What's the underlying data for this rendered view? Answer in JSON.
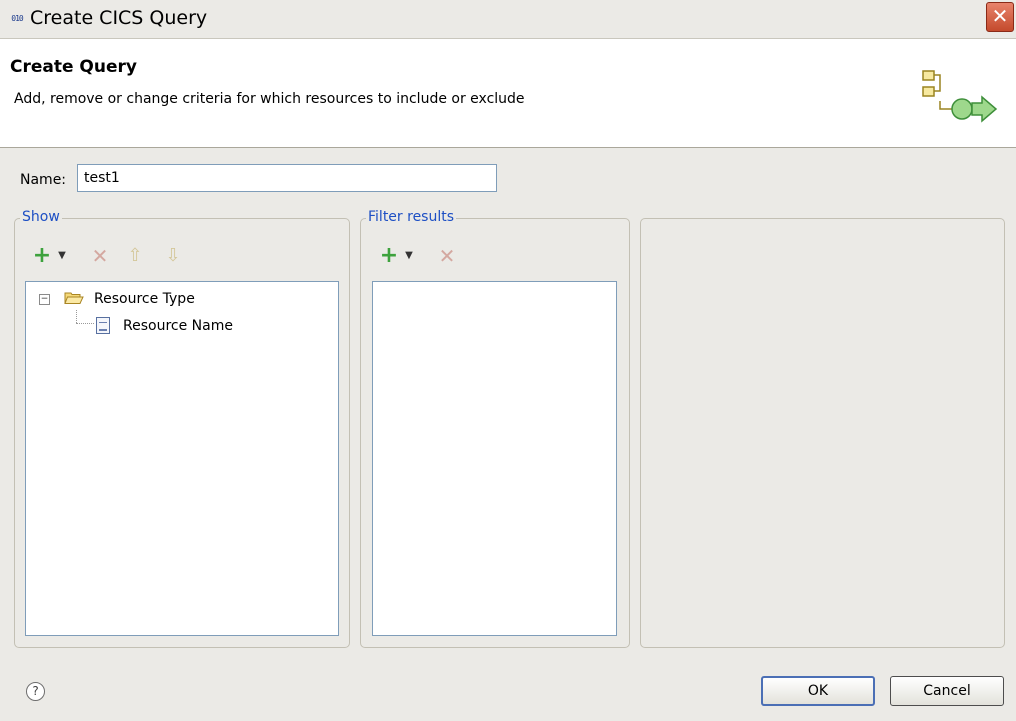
{
  "window": {
    "title": "Create CICS Query",
    "title_icon_text": "010",
    "close_glyph": "✕"
  },
  "header": {
    "title": "Create Query",
    "description": "Add, remove or change criteria for which resources to include or exclude",
    "graphic_icon": "query-wizard-graphic"
  },
  "name_field": {
    "label": "Name:",
    "value": "test1"
  },
  "show_group": {
    "legend": "Show",
    "toolbar": {
      "add_icon": "add-icon",
      "dropdown_icon": "dropdown-arrow-icon",
      "delete_icon": "delete-icon",
      "move_up_icon": "arrow-up-icon",
      "move_down_icon": "arrow-down-icon"
    },
    "tree": [
      {
        "label": "Resource Type",
        "icon": "folder-open-icon",
        "expanded": true
      },
      {
        "label": "Resource Name",
        "icon": "document-icon"
      }
    ]
  },
  "filter_group": {
    "legend": "Filter results",
    "toolbar": {
      "add_icon": "add-icon",
      "dropdown_icon": "dropdown-arrow-icon",
      "delete_icon": "delete-icon"
    }
  },
  "footer": {
    "help_glyph": "?",
    "ok_label": "OK",
    "cancel_label": "Cancel"
  }
}
